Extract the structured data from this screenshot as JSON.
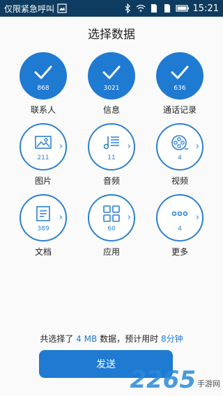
{
  "status_bar": {
    "carrier_text": "仅限紧急呼叫",
    "time": "15:21"
  },
  "page_title": "选择数据",
  "items": [
    {
      "label": "联系人",
      "count": "868",
      "selected": true,
      "icon": "check-icon"
    },
    {
      "label": "信息",
      "count": "3021",
      "selected": true,
      "icon": "check-icon"
    },
    {
      "label": "通话记录",
      "count": "636",
      "selected": true,
      "icon": "check-icon"
    },
    {
      "label": "图片",
      "count": "211",
      "selected": false,
      "icon": "image-icon"
    },
    {
      "label": "音频",
      "count": "11",
      "selected": false,
      "icon": "music-icon"
    },
    {
      "label": "视频",
      "count": "4",
      "selected": false,
      "icon": "video-reel-icon"
    },
    {
      "label": "文档",
      "count": "389",
      "selected": false,
      "icon": "document-icon"
    },
    {
      "label": "应用",
      "count": "60",
      "selected": false,
      "icon": "apps-grid-icon"
    },
    {
      "label": "更多",
      "count": "4",
      "selected": false,
      "icon": "more-dots-icon"
    }
  ],
  "summary": {
    "prefix": "共选择了",
    "size": "4 MB",
    "middle": "数据，预计用时",
    "duration": "8分钟"
  },
  "send_button_label": "发送",
  "watermark": {
    "number": "2265",
    "text": "手游网"
  },
  "colors": {
    "accent": "#1f7ad2",
    "status_bar": "#0e3c60"
  }
}
